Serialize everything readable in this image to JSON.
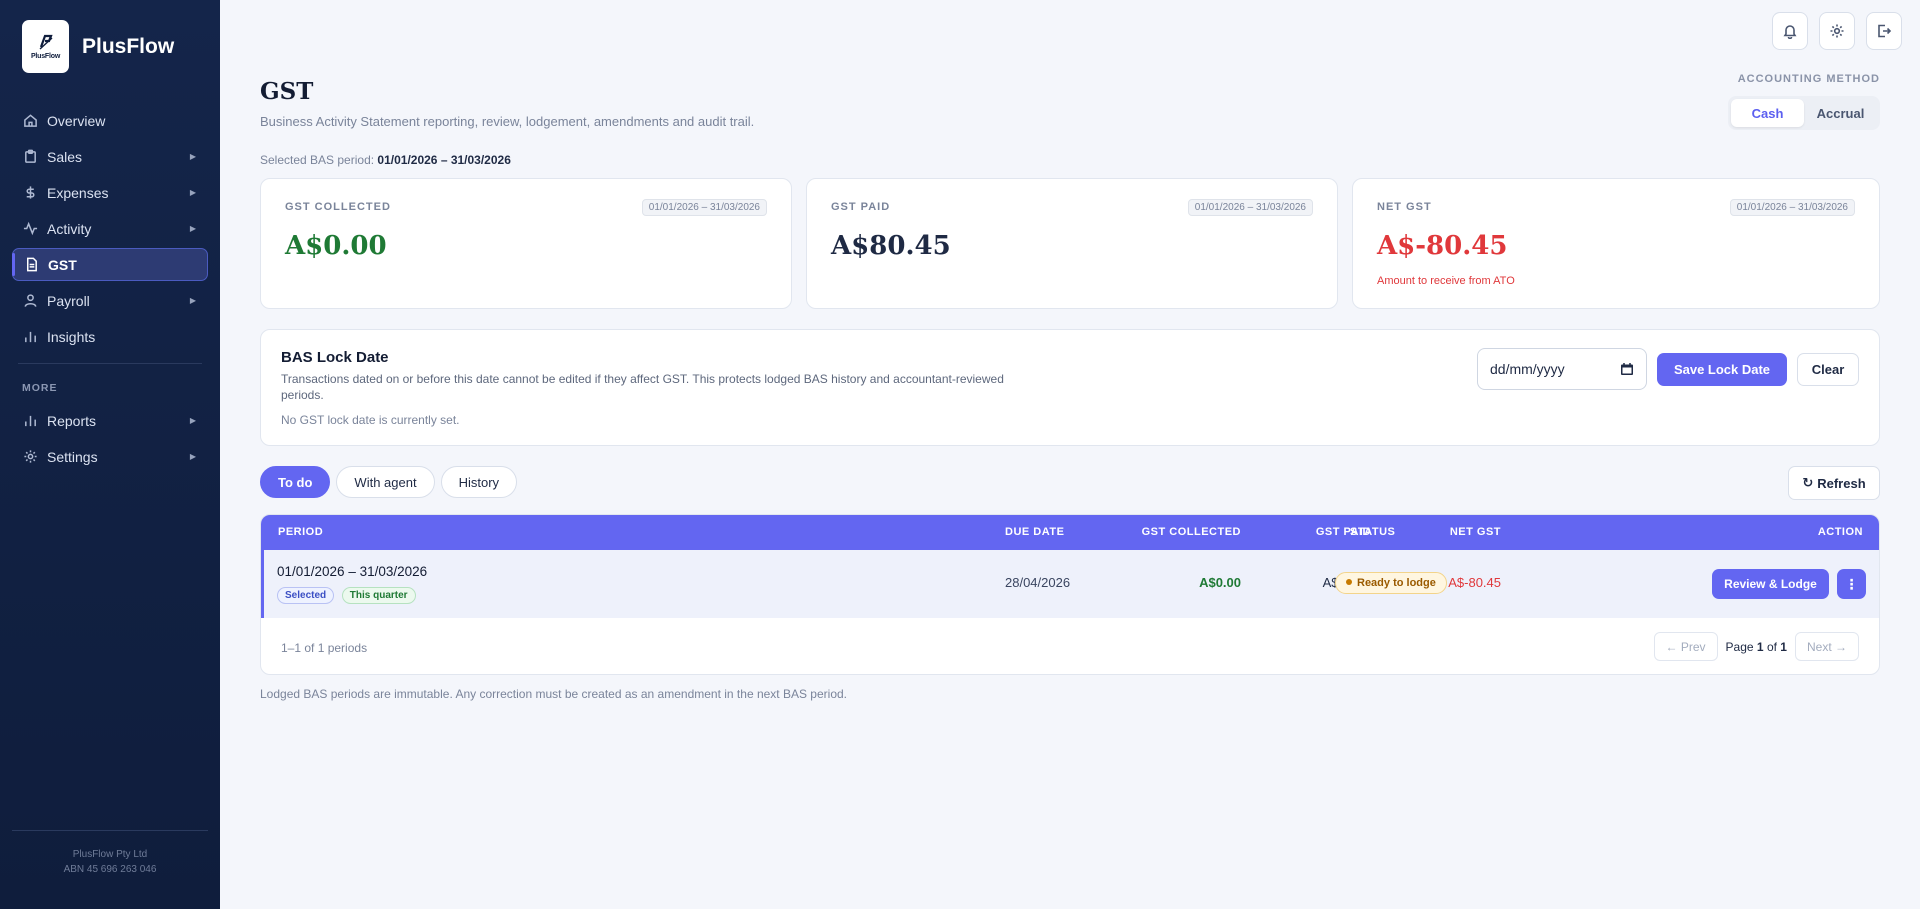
{
  "app": {
    "name": "PlusFlow",
    "logo_text": "PlusFlow"
  },
  "sidebar": {
    "items": [
      {
        "label": "Overview",
        "icon": "home-icon",
        "has_children": false
      },
      {
        "label": "Sales",
        "icon": "clipboard-icon",
        "has_children": true
      },
      {
        "label": "Expenses",
        "icon": "dollar-icon",
        "has_children": true
      },
      {
        "label": "Activity",
        "icon": "activity-icon",
        "has_children": true
      },
      {
        "label": "GST",
        "icon": "document-icon",
        "has_children": false,
        "active": true
      },
      {
        "label": "Payroll",
        "icon": "user-icon",
        "has_children": true
      },
      {
        "label": "Insights",
        "icon": "bar-chart-icon",
        "has_children": false
      }
    ],
    "section_more": "MORE",
    "more_items": [
      {
        "label": "Reports",
        "icon": "bar-chart-icon",
        "has_children": true
      },
      {
        "label": "Settings",
        "icon": "gear-icon",
        "has_children": true
      }
    ],
    "footer": {
      "company": "PlusFlow Pty Ltd",
      "abn": "ABN 45 696 263 046"
    }
  },
  "top_icons": [
    "bell-icon",
    "gear-icon",
    "logout-icon"
  ],
  "header": {
    "title": "GST",
    "subtitle": "Business Activity Statement reporting, review, lodgement, amendments and audit trail.",
    "selected_period_label": "Selected BAS period:",
    "selected_period_value": "01/01/2026 – 31/03/2026"
  },
  "accounting_method": {
    "label": "ACCOUNTING METHOD",
    "options": [
      "Cash",
      "Accrual"
    ],
    "selected": "Cash"
  },
  "stats": [
    {
      "label": "GST COLLECTED",
      "period": "01/01/2026 – 31/03/2026",
      "value": "A$0.00",
      "color": "#1f7a35",
      "note": ""
    },
    {
      "label": "GST PAID",
      "period": "01/01/2026 – 31/03/2026",
      "value": "A$80.45",
      "color": "#1f2a44",
      "note": ""
    },
    {
      "label": "NET GST",
      "period": "01/01/2026 – 31/03/2026",
      "value": "A$-80.45",
      "color": "#e0383b",
      "note": "Amount to receive from ATO"
    }
  ],
  "lock": {
    "title": "BAS Lock Date",
    "description": "Transactions dated on or before this date cannot be edited if they affect GST. This protects lodged BAS history and accountant-reviewed periods.",
    "status": "No GST lock date is currently set.",
    "date_placeholder": "dd/mm/yyyy",
    "save_label": "Save Lock Date",
    "clear_label": "Clear"
  },
  "tabs": [
    "To do",
    "With agent",
    "History"
  ],
  "active_tab": "To do",
  "refresh_label": "Refresh",
  "table": {
    "columns": [
      "PERIOD",
      "DUE DATE",
      "GST COLLECTED",
      "GST PAID",
      "NET GST",
      "STATUS",
      "ACTION"
    ],
    "rows": [
      {
        "period": "01/01/2026 – 31/03/2026",
        "badges": [
          "Selected",
          "This quarter"
        ],
        "due_date": "28/04/2026",
        "gst_collected": "A$0.00",
        "gst_paid": "A$80.45",
        "net_gst": "A$-80.45",
        "status": "Ready to lodge",
        "action_label": "Review & Lodge"
      }
    ],
    "count_text": "1–1 of 1 periods",
    "pager": {
      "prev": "← Prev",
      "page_word": "Page",
      "page": "1",
      "of_word": "of",
      "total": "1",
      "next": "Next →"
    }
  },
  "footer_note": "Lodged BAS periods are immutable. Any correction must be created as an amendment in the next BAS period.",
  "colors": {
    "accent": "#6366f1",
    "sidebar": "#14254a",
    "positive": "#1f7a35",
    "negative": "#e0383b"
  }
}
